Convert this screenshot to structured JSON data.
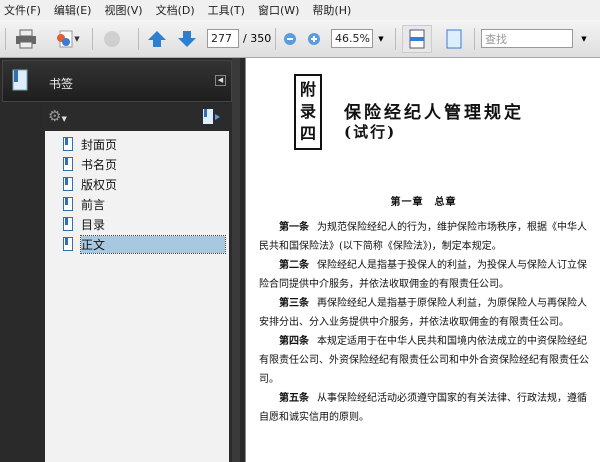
{
  "menu": [
    "文件(F)",
    "编辑(E)",
    "视图(V)",
    "文档(D)",
    "工具(T)",
    "窗口(W)",
    "帮助(H)"
  ],
  "toolbar": {
    "page_current": "277",
    "page_total": "/ 350",
    "zoom": "46.5%",
    "search_placeholder": "查找"
  },
  "panel": {
    "title": "书签",
    "bookmarks": [
      "封面页",
      "书名页",
      "版权页",
      "前言",
      "目录",
      "正文"
    ],
    "selected": "正文"
  },
  "document": {
    "appendix": [
      "附",
      "录",
      "四"
    ],
    "title": "保险经纪人管理规定",
    "subtitle": "(试行)",
    "chapter": "第一章　总章",
    "articles": [
      {
        "label": "第一条",
        "text": "为规范保险经纪人的行为，维护保险市场秩序，根据《中华人民共和国保险法》(以下简称《保险法》)，制定本规定。"
      },
      {
        "label": "第二条",
        "text": "保险经纪人是指基于投保人的利益，为投保人与保险人订立保险合同提供中介服务，并依法收取佣金的有限责任公司。"
      },
      {
        "label": "第三条",
        "text": "再保险经纪人是指基于原保险人利益，为原保险人与再保险人安排分出、分入业务提供中介服务，并依法收取佣金的有限责任公司。"
      },
      {
        "label": "第四条",
        "text": "本规定适用于在中华人民共和国境内依法成立的中资保险经纪有限责任公司、外资保险经纪有限责任公司和中外合资保险经纪有限责任公司。"
      },
      {
        "label": "第五条",
        "text": "从事保险经纪活动必须遵守国家的有关法律、行政法规，遵循自愿和诚实信用的原则。"
      }
    ]
  }
}
